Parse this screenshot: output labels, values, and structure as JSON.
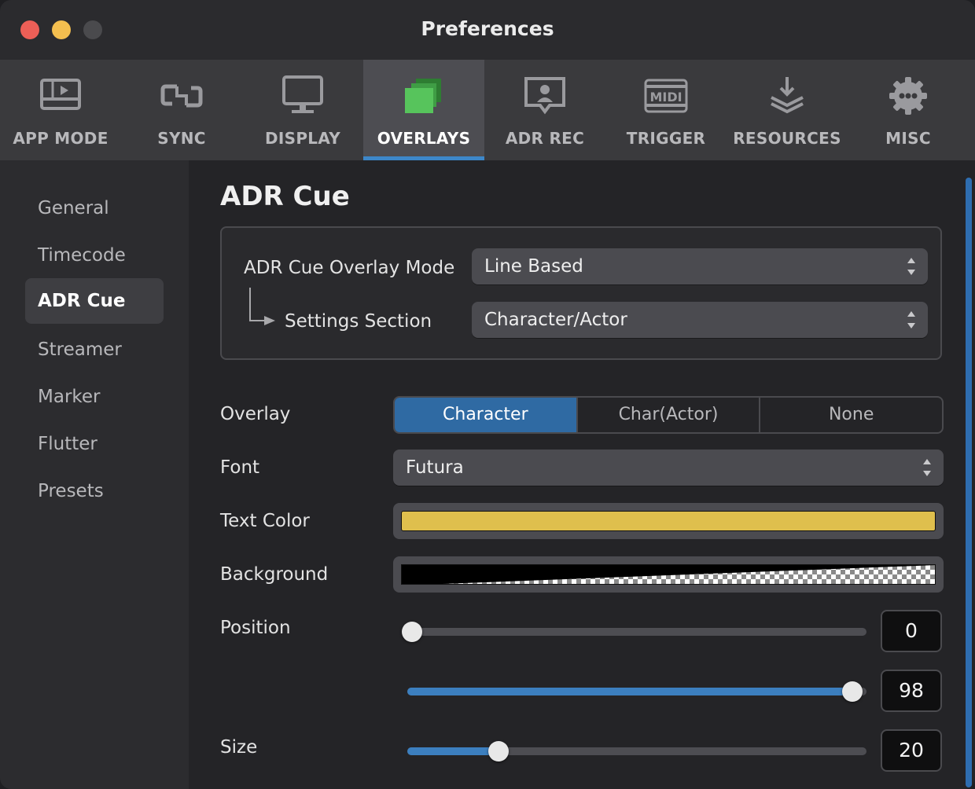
{
  "window": {
    "title": "Preferences"
  },
  "toolbar": {
    "items": [
      {
        "label": "APP MODE",
        "icon": "app-mode-icon"
      },
      {
        "label": "SYNC",
        "icon": "sync-icon"
      },
      {
        "label": "DISPLAY",
        "icon": "display-icon"
      },
      {
        "label": "OVERLAYS",
        "icon": "overlays-icon",
        "active": true
      },
      {
        "label": "ADR REC",
        "icon": "adr-rec-icon"
      },
      {
        "label": "TRIGGER",
        "icon": "midi-icon"
      },
      {
        "label": "RESOURCES",
        "icon": "resources-icon"
      },
      {
        "label": "MISC",
        "icon": "gear-icon"
      }
    ],
    "accent": "#3d87c9"
  },
  "sidebar": {
    "items": [
      {
        "label": "General"
      },
      {
        "label": "Timecode"
      },
      {
        "label": "ADR Cue",
        "active": true
      },
      {
        "label": "Streamer"
      },
      {
        "label": "Marker"
      },
      {
        "label": "Flutter"
      },
      {
        "label": "Presets"
      }
    ]
  },
  "main": {
    "heading": "ADR Cue",
    "overlay_mode": {
      "label": "ADR Cue Overlay Mode",
      "value": "Line Based"
    },
    "settings_section": {
      "label": "Settings Section",
      "value": "Character/Actor"
    },
    "overlay": {
      "label": "Overlay",
      "options": [
        "Character",
        "Char(Actor)",
        "None"
      ],
      "selected": "Character"
    },
    "font": {
      "label": "Font",
      "value": "Futura"
    },
    "text_color": {
      "label": "Text Color",
      "color": "#dfbf4d"
    },
    "background": {
      "label": "Background",
      "color": "#000000"
    },
    "position": {
      "label": "Position",
      "start": "0",
      "end": "98"
    },
    "size": {
      "label": "Size",
      "value": "20"
    }
  }
}
